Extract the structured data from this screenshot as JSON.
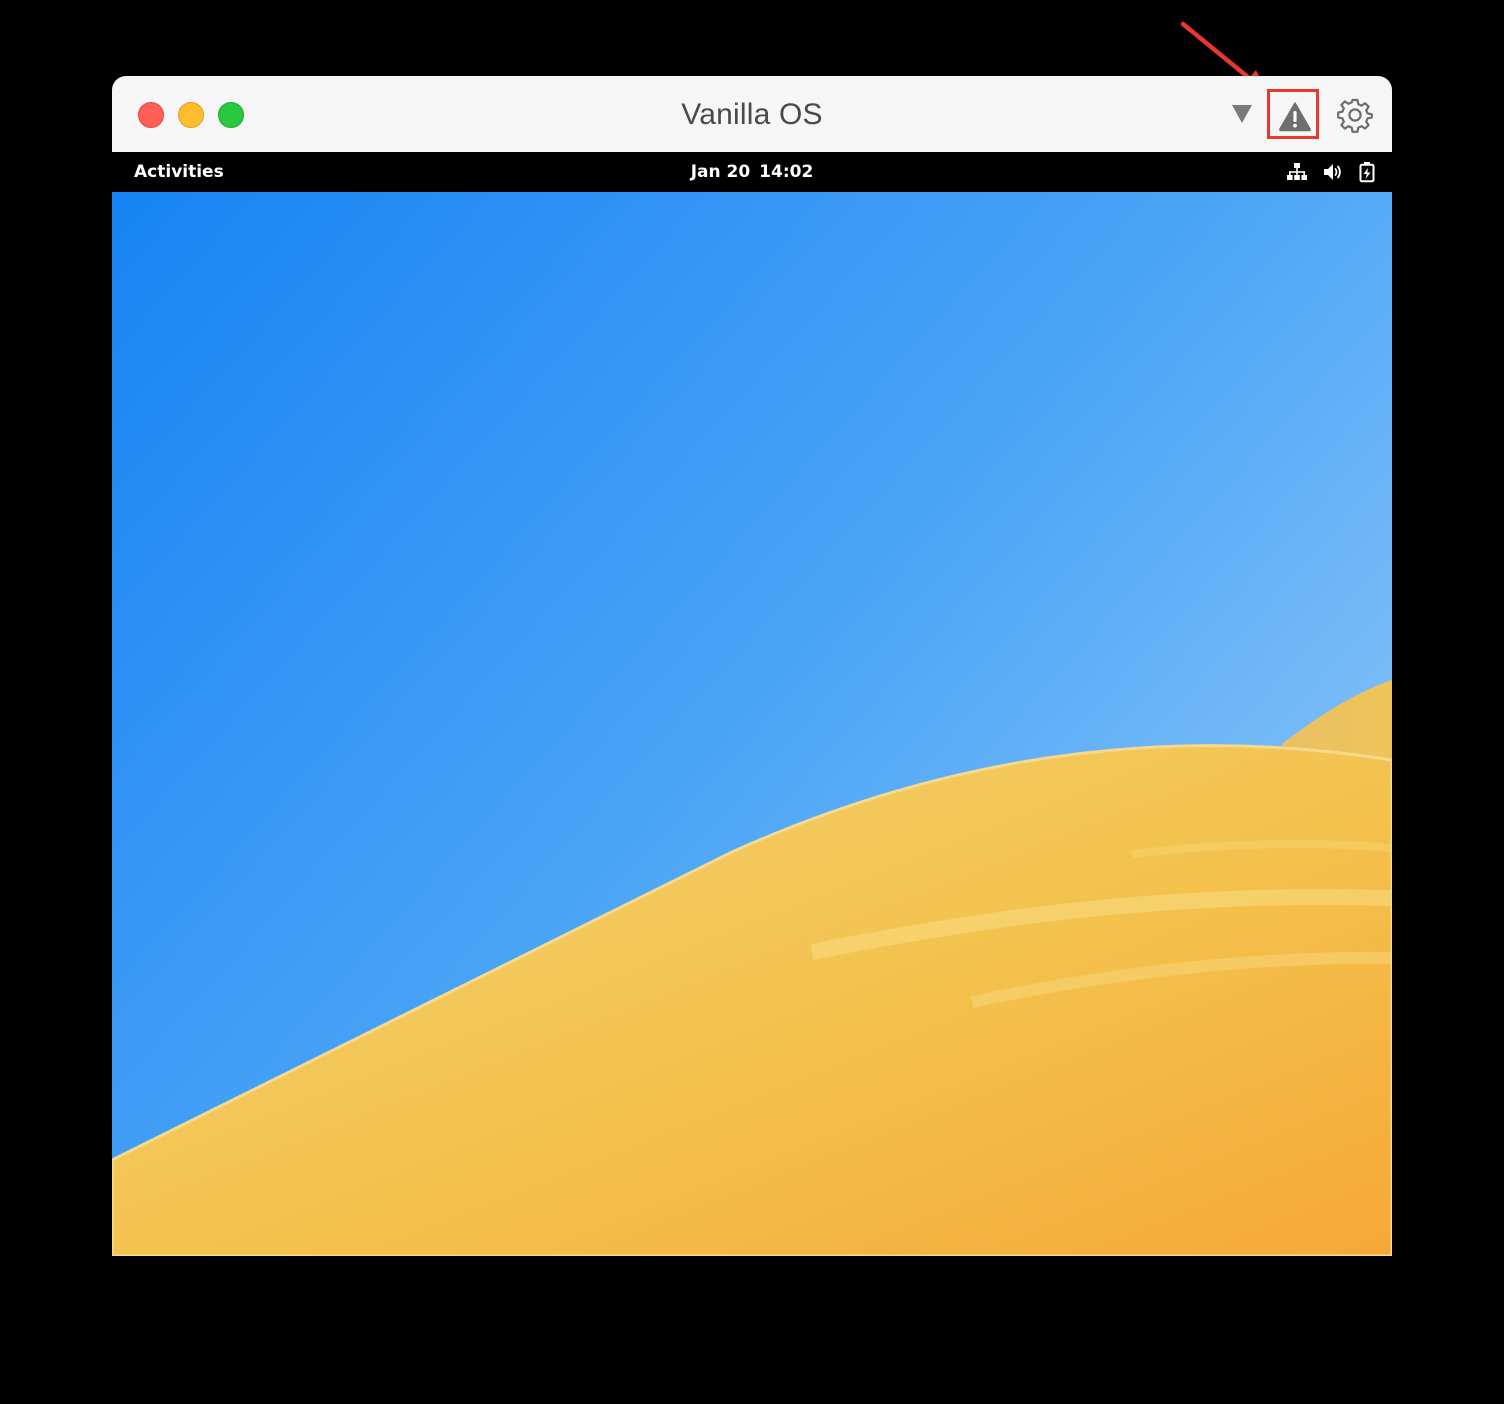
{
  "window": {
    "title": "Vanilla OS",
    "controls": [
      "close",
      "minimize",
      "zoom"
    ],
    "toolbar": {
      "dropdown_icon": "triangle-down-icon",
      "warning_icon": "warning-icon",
      "settings_icon": "gear-icon"
    }
  },
  "topbar": {
    "activities": "Activities",
    "date": "Jan 20",
    "time": "14:02",
    "tray_icons": [
      "network-wired-icon",
      "volume-icon",
      "battery-charging-icon"
    ]
  },
  "annotation": {
    "highlight_target": "warning-icon",
    "color": "#e8372c"
  },
  "colors": {
    "sky_top": "#1783f4",
    "sky_bottom": "#7cbdf8",
    "dune": "#f3c24d",
    "dune_deep": "#f5ac3a"
  }
}
